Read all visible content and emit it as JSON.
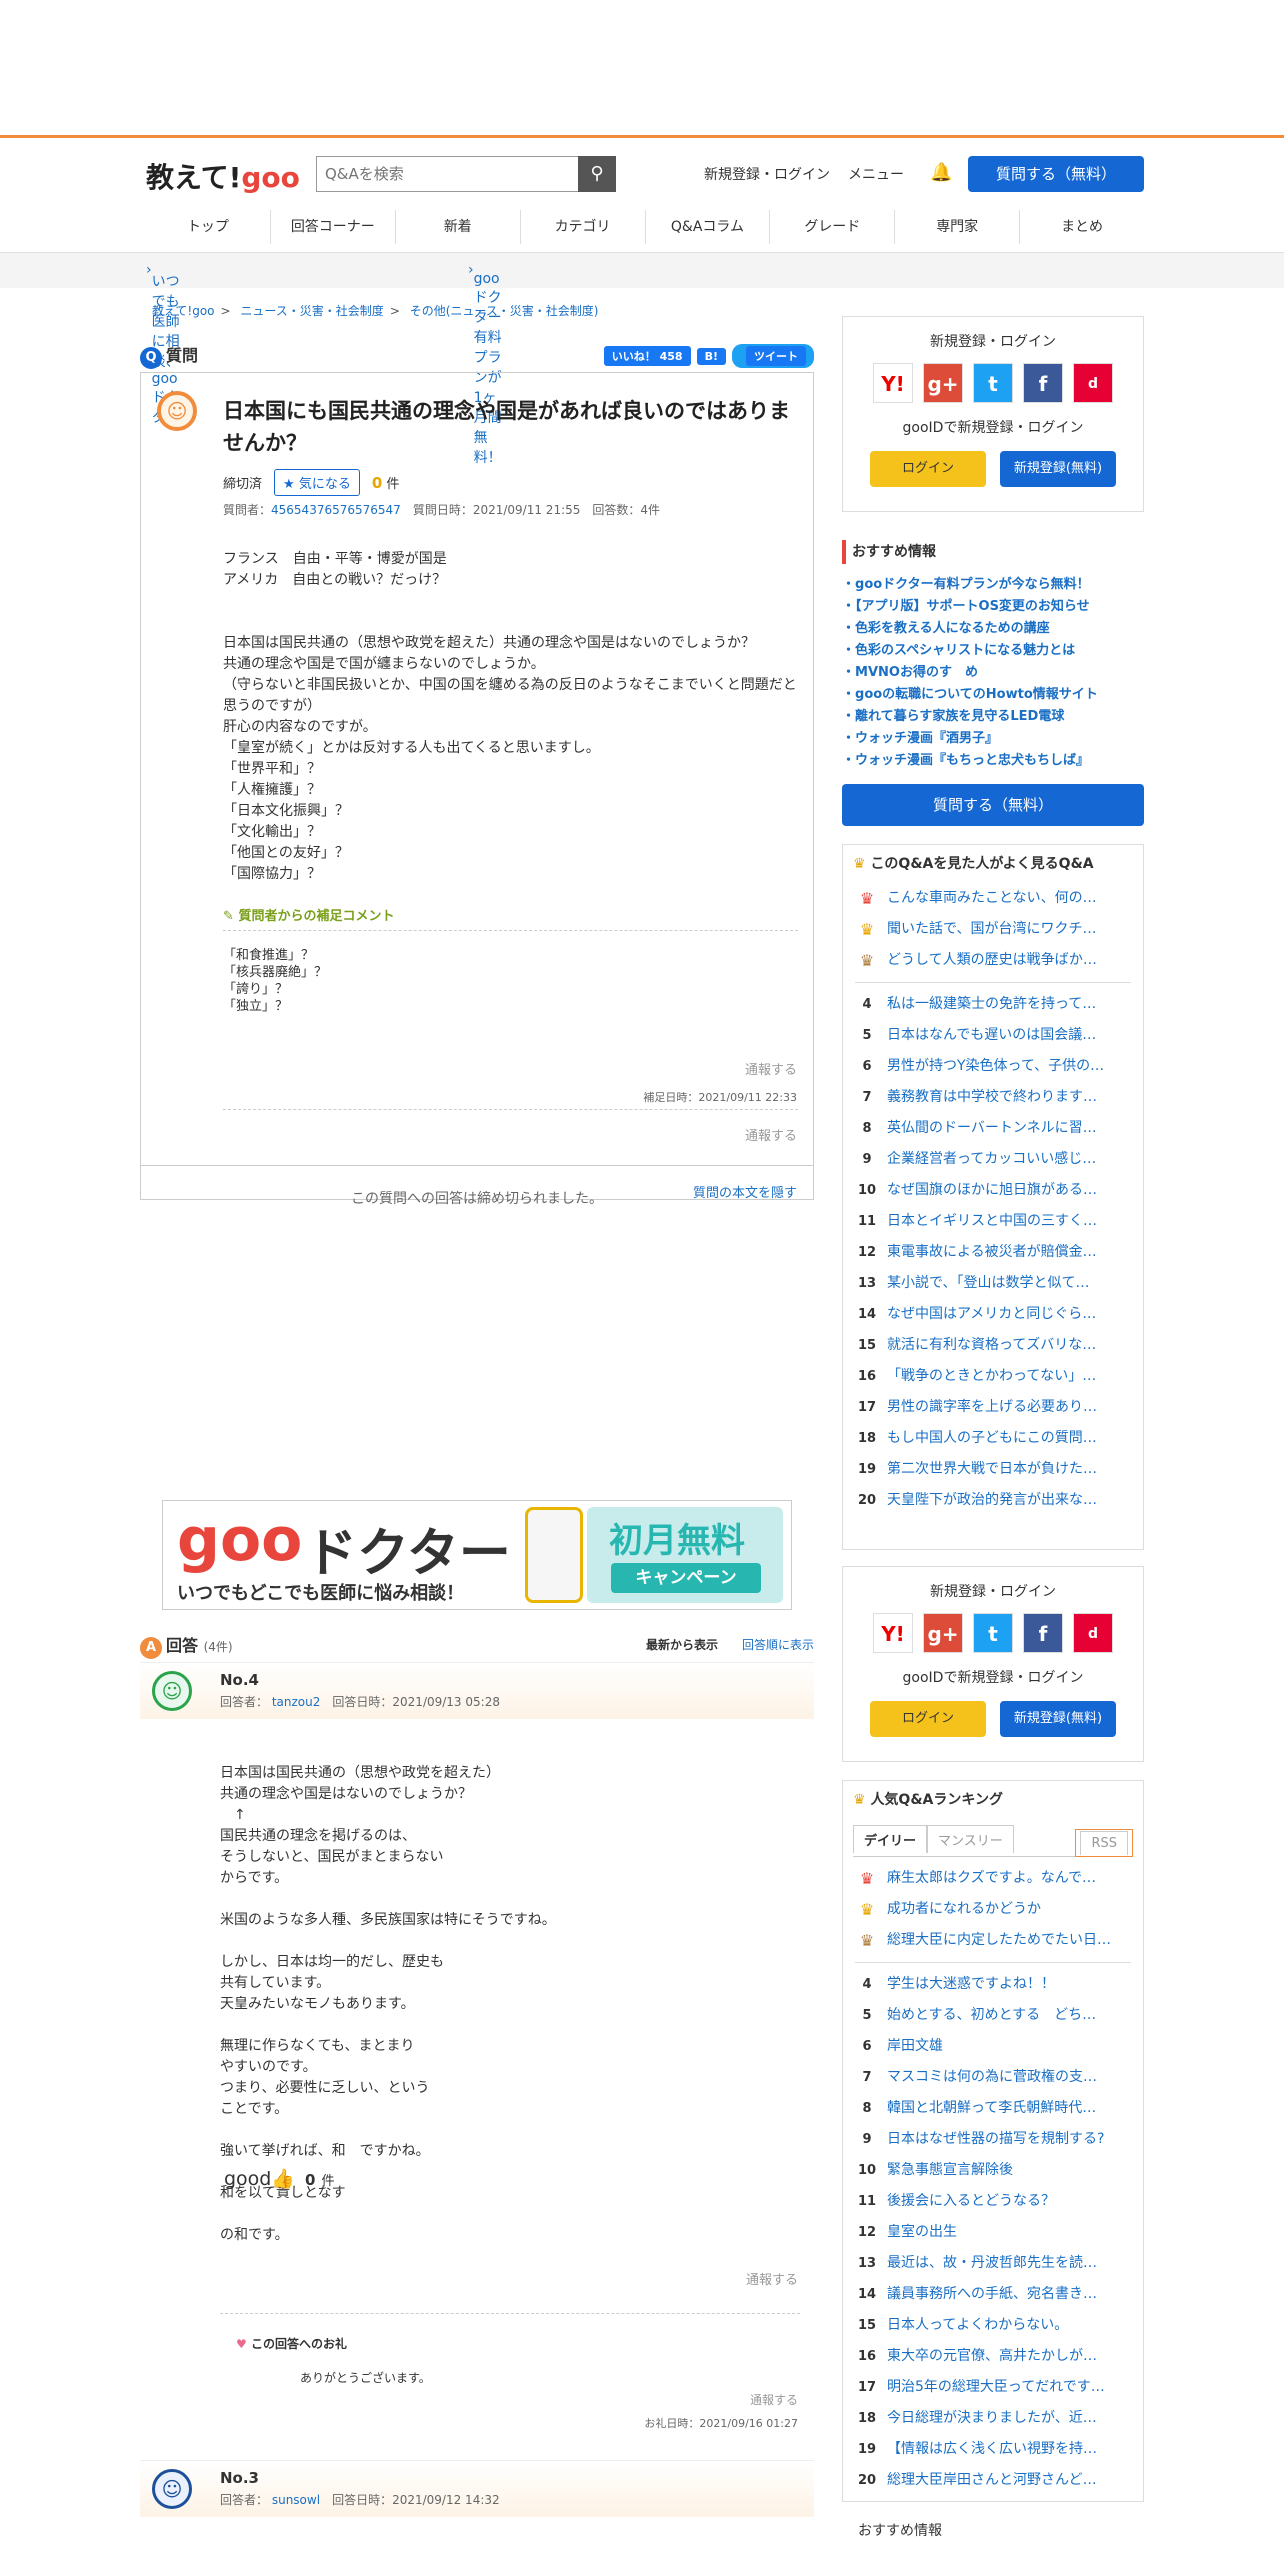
{
  "header": {
    "logo_prefix": "教えて!",
    "logo_goo": "goo",
    "search_placeholder": "Q&Aを検索",
    "signup": "新規登録・ログイン",
    "menu": "メニュー",
    "ask": "質問する（無料）"
  },
  "nav": [
    "トップ",
    "回答コーナー",
    "新着",
    "カテゴリ",
    "Q&Aコラム",
    "グレード",
    "専門家",
    "まとめ"
  ],
  "promo": [
    "いつでも医師に相談、gooドクター",
    "gooドクター有料プランが1ヶ月間無料！"
  ],
  "breadcrumb": [
    "教えて!goo",
    "ニュース・災害・社会制度",
    "その他(ニュース・災害・社会制度)"
  ],
  "question": {
    "section": "質問",
    "like": "いいね！ 458",
    "tweet": "ツイート",
    "title": "日本国にも国民共通の理念や国是があれば良いのではありませんか？",
    "status": "締切済",
    "follow": "気になる",
    "count": "0",
    "count_unit": "件",
    "meta_label": "質問者：",
    "meta_user": "45654376576576547",
    "meta_date": "質問日時：2021/09/11 21:55　回答数：4件",
    "body": "フランス　自由・平等・博愛が国是\nアメリカ　自由との戦い？だっけ？\n\n\n日本国は国民共通の（思想や政党を超えた）共通の理念や国是はないのでしょうか？\n共通の理念や国是で国が纏まらないのでしょうか。\n（守らないと非国民扱いとか、中国の国を纏める為の反日のようなそこまでいくと問題だと思うのですが）\n肝心の内容なのですが。\n「皇室が続く」とかは反対する人も出てくると思いますし。\n「世界平和」？\n「人権擁護」？\n「日本文化振興」？\n「文化輸出」？\n「他国との友好」？\n「国際協力」？",
    "supp_title": "質問者からの補足コメント",
    "supp_body": "「和食推進」？\n「核兵器廃絶」？\n「誇り」？\n「独立」？",
    "report": "通報する",
    "supp_date": "補足日時：2021/09/11 22:33",
    "closed": "この質問への回答は締め切られました。",
    "hide": "質問の本文を隠す"
  },
  "ad": {
    "goo": "goo",
    "doctor": "ドクター",
    "sub": "いつでもどこでも医師に悩み相談！",
    "free": "初月無料",
    "campaign": "キャンペーン"
  },
  "answers": {
    "section": "回答",
    "count": "(4件)",
    "sort_new": "最新から表示",
    "sort_old": "回答順に表示",
    "a4": {
      "no": "No.4",
      "label": "回答者：",
      "user": "tanzou2",
      "date": "回答日時：2021/09/13 05:28",
      "body": "日本国は国民共通の（思想や政党を超えた）\n共通の理念や国是はないのでしょうか？\n　↑\n国民共通の理念を掲げるのは、\nそうしないと、国民がまとまらない\nからです。\n\n米国のような多人種、多民族国家は特にそうですね。\n\nしかし、日本は均一的だし、歴史も\n共有しています。\n天皇みたいなモノもあります。\n\n無理に作らなくても、まとまり\nやすいのです。\nつまり、必要性に乏しい、という\nことです。\n\n強いて挙げれば、和　ですかね。\n\n和を以て貴しとなす\n\nの和です。",
      "good": "good",
      "good_count": "0",
      "good_unit": "件",
      "report": "通報する",
      "thanks_title": "この回答へのお礼",
      "thanks_body": "ありがとうございます。",
      "thanks_date": "お礼日時：2021/09/16 01:27"
    },
    "a3": {
      "no": "No.3",
      "label": "回答者：",
      "user": "sunsowl",
      "date": "回答日時：2021/09/12 14:32"
    }
  },
  "sidebar": {
    "login_title": "新規登録・ログイン",
    "gooid": "gooIDで新規登録・ログイン",
    "login": "ログイン",
    "register": "新規登録(無料)",
    "reco_title": "おすすめ情報",
    "reco": [
      "gooドクター有料プランが今なら無料！",
      "【アプリ版】サポートOS変更のお知らせ",
      "色彩を教える人になるための講座",
      "色彩のスペシャリストになる魅力とは",
      "MVNOお得のす　め",
      "gooの転職についてのHowto情報サイト",
      "離れて暮らす家族を見守るLED電球",
      "ウォッチ漫画『酒男子』",
      "ウォッチ漫画『もちっと忠犬もちしば』"
    ],
    "ask": "質問する（無料）",
    "also_title": "このQ&Aを見た人がよく見るQ&A",
    "also": [
      "こんな車両みたことない、何の…",
      "聞いた話で、国が台湾にワクチ…",
      "どうして人類の歴史は戦争ばか…",
      "私は一級建築士の免許を持って…",
      "日本はなんでも遅いのは国会議…",
      "男性が持つY染色体って、子供の…",
      "義務教育は中学校で終わります…",
      "英仏間のドーバートンネルに習…",
      "企業経営者ってカッコいい感じ…",
      "なぜ国旗のほかに旭日旗がある…",
      "日本とイギリスと中国の三すく…",
      "東電事故による被災者が賠償金…",
      "某小説で、「登山は数学と似て…",
      "なぜ中国はアメリカと同じぐら…",
      "就活に有利な資格ってズバリな…",
      "「戦争のときとかわってない」…",
      "男性の識字率を上げる必要あり…",
      "もし中国人の子どもにこの質問…",
      "第二次世界大戦で日本が負けた…",
      "天皇陛下が政治的発言が出来な…"
    ],
    "rank_title": "人気Q&Aランキング",
    "tab_daily": "デイリー",
    "tab_monthly": "マンスリー",
    "rss": "RSS",
    "rank": [
      "麻生太郎はクズですよ。なんで…",
      "成功者になれるかどうか",
      "総理大臣に内定したためでたい日…",
      "学生は大迷惑ですよね！！",
      "始めとする、初めとする　どち…",
      "岸田文雄",
      "マスコミは何の為に菅政権の支…",
      "韓国と北朝鮮って李氏朝鮮時代…",
      "日本はなぜ性器の描写を規制する?",
      "緊急事態宣言解除後",
      "後援会に入るとどうなる？",
      "皇室の出生",
      "最近は、故・丹波哲郎先生を読…",
      "議員事務所への手紙、宛名書き…",
      "日本人ってよくわからない。",
      "東大卒の元官僚、高井たかしが…",
      "明治5年の総理大臣ってだれです…",
      "今日総理が決まりましたが、近…",
      "【情報は広く浅く広い視野を持…",
      "総理大臣岸田さんと河野さんど…"
    ],
    "reco2_title": "おすすめ情報"
  }
}
